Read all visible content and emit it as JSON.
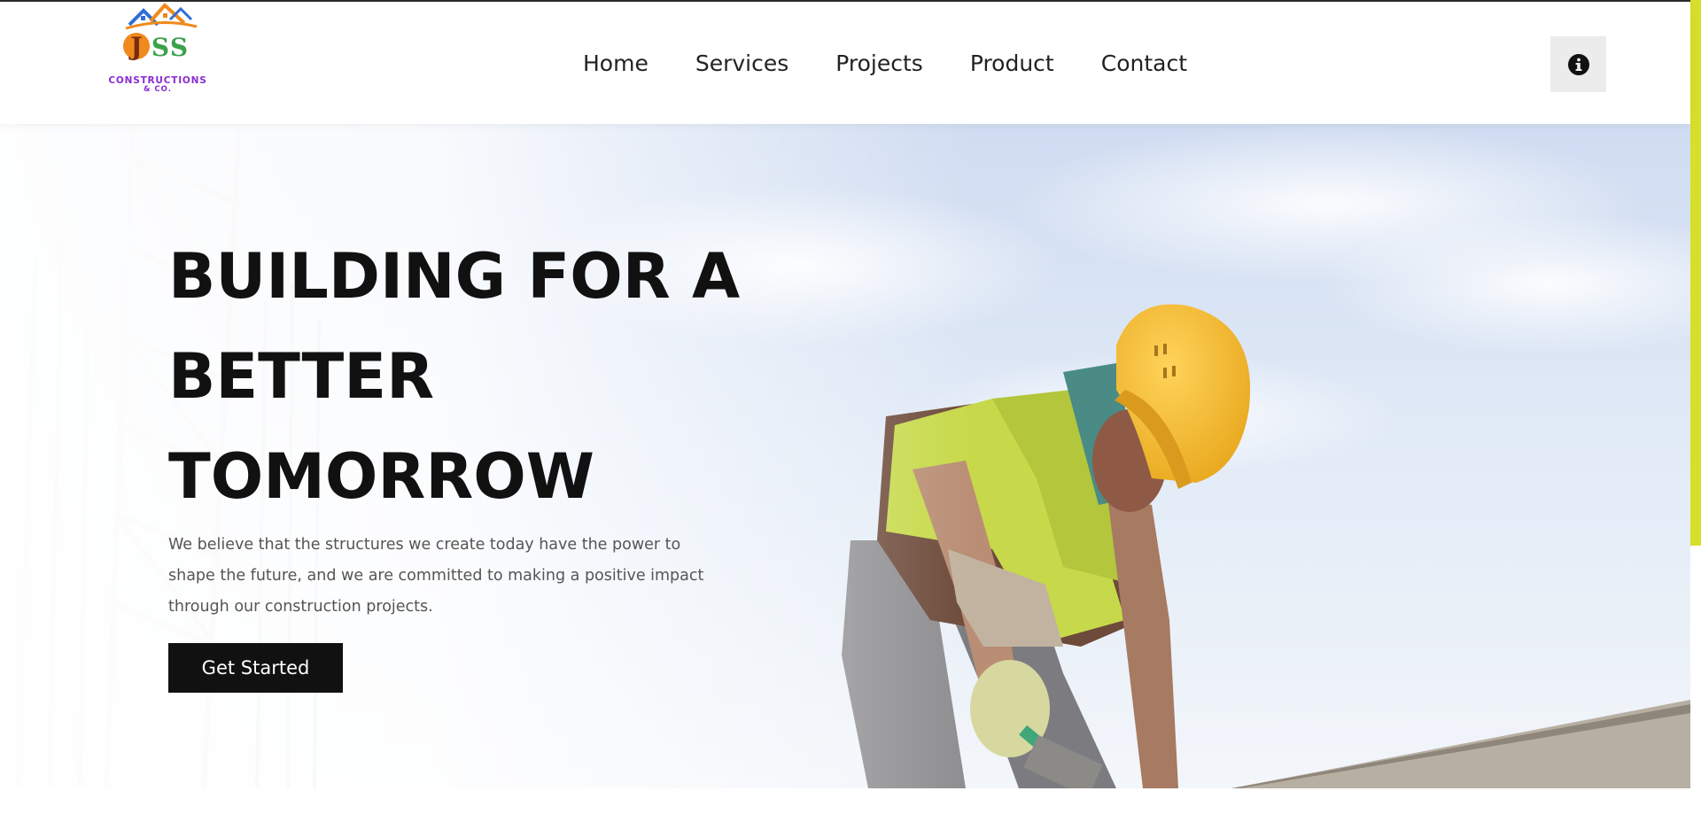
{
  "brand": {
    "logo_letters": "JSS",
    "logo_line1": "CONSTRUCTIONS",
    "logo_line2": "& CO."
  },
  "nav": {
    "items": [
      "Home",
      "Services",
      "Projects",
      "Product",
      "Contact"
    ]
  },
  "header": {
    "info_icon": "info-circle-icon"
  },
  "hero": {
    "title_lines": [
      "BUILDING FOR A",
      "BETTER",
      "TOMORROW"
    ],
    "description": "We believe that the structures we create today have the power to shape the future, and we are committed to making a positive impact through our construction projects.",
    "cta_label": "Get Started"
  },
  "colors": {
    "accent_yellow": "#d7df2b",
    "text_dark": "#111111",
    "brand_purple": "#8a2bd0",
    "logo_orange": "#f08a1c",
    "logo_blue": "#2f6fd6",
    "logo_green": "#3aa24a"
  }
}
